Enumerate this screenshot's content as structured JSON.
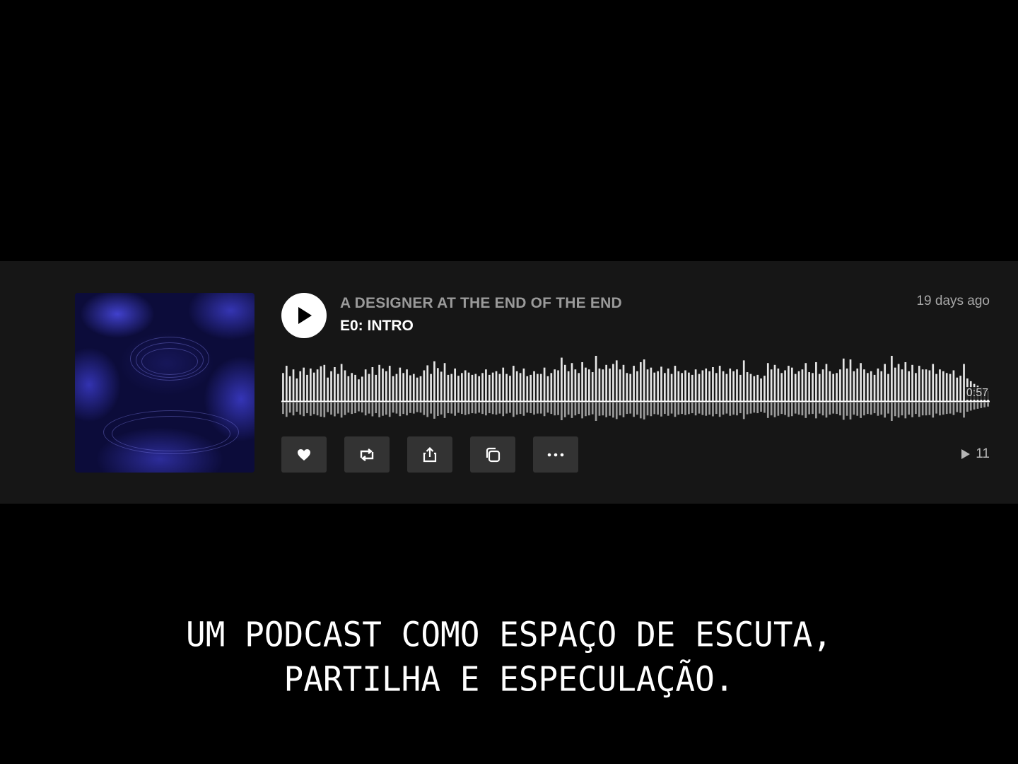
{
  "track": {
    "show_title": "A DESIGNER AT THE END OF THE END",
    "episode_title": "E0: INTRO",
    "posted": "19 days ago",
    "duration": "0:57",
    "play_count": "11"
  },
  "waveform": {
    "bars": [
      0.62,
      0.78,
      0.55,
      0.7,
      0.5,
      0.66,
      0.74,
      0.58,
      0.72,
      0.63,
      0.7,
      0.77,
      0.8,
      0.52,
      0.66,
      0.75,
      0.6,
      0.82,
      0.68,
      0.55,
      0.62,
      0.58,
      0.48,
      0.54,
      0.7,
      0.6,
      0.75,
      0.58,
      0.8,
      0.72,
      0.66,
      0.78,
      0.55,
      0.6,
      0.74,
      0.62,
      0.7,
      0.57,
      0.6,
      0.52,
      0.55,
      0.68,
      0.79,
      0.6,
      0.88,
      0.73,
      0.65,
      0.84,
      0.58,
      0.6,
      0.72,
      0.56,
      0.62,
      0.68,
      0.63,
      0.58,
      0.6,
      0.55,
      0.62,
      0.7,
      0.58,
      0.63,
      0.66,
      0.6,
      0.74,
      0.6,
      0.56,
      0.78,
      0.66,
      0.62,
      0.72,
      0.55,
      0.58,
      0.66,
      0.6,
      0.6,
      0.74,
      0.55,
      0.62,
      0.7,
      0.68,
      0.96,
      0.8,
      0.66,
      0.84,
      0.7,
      0.62,
      0.86,
      0.74,
      0.7,
      0.64,
      1.0,
      0.72,
      0.7,
      0.8,
      0.72,
      0.82,
      0.9,
      0.7,
      0.8,
      0.62,
      0.6,
      0.78,
      0.66,
      0.86,
      0.92,
      0.7,
      0.74,
      0.63,
      0.66,
      0.76,
      0.62,
      0.72,
      0.6,
      0.78,
      0.66,
      0.62,
      0.68,
      0.63,
      0.58,
      0.7,
      0.6,
      0.68,
      0.72,
      0.66,
      0.75,
      0.62,
      0.78,
      0.66,
      0.6,
      0.72,
      0.66,
      0.7,
      0.58,
      0.9,
      0.64,
      0.6,
      0.55,
      0.58,
      0.5,
      0.56,
      0.84,
      0.7,
      0.8,
      0.72,
      0.62,
      0.68,
      0.78,
      0.74,
      0.6,
      0.66,
      0.7,
      0.84,
      0.64,
      0.62,
      0.86,
      0.6,
      0.7,
      0.82,
      0.66,
      0.6,
      0.62,
      0.7,
      0.94,
      0.72,
      0.92,
      0.66,
      0.72,
      0.84,
      0.7,
      0.62,
      0.66,
      0.58,
      0.72,
      0.66,
      0.82,
      0.6,
      1.0,
      0.74,
      0.82,
      0.7,
      0.86,
      0.66,
      0.8,
      0.62,
      0.78,
      0.7,
      0.7,
      0.68,
      0.82,
      0.6,
      0.7,
      0.66,
      0.62,
      0.6,
      0.68,
      0.52,
      0.56,
      0.82,
      0.5,
      0.44,
      0.38,
      0.34,
      0.3,
      0.26,
      0.22
    ],
    "played_fraction": 0.0
  },
  "actions": {
    "like": "heart-icon",
    "repost": "repost-icon",
    "share": "share-icon",
    "copy": "copy-icon",
    "more": "more-icon"
  },
  "caption": {
    "line1": "UM PODCAST COMO ESPAÇO DE ESCUTA,",
    "line2": "PARTILHA E ESPECULAÇÃO."
  },
  "colors": {
    "background": "#000000",
    "panel": "#161616",
    "button": "#333333",
    "waveform": "#e6e6e6",
    "artwork_blue": "#3a3ad0"
  }
}
